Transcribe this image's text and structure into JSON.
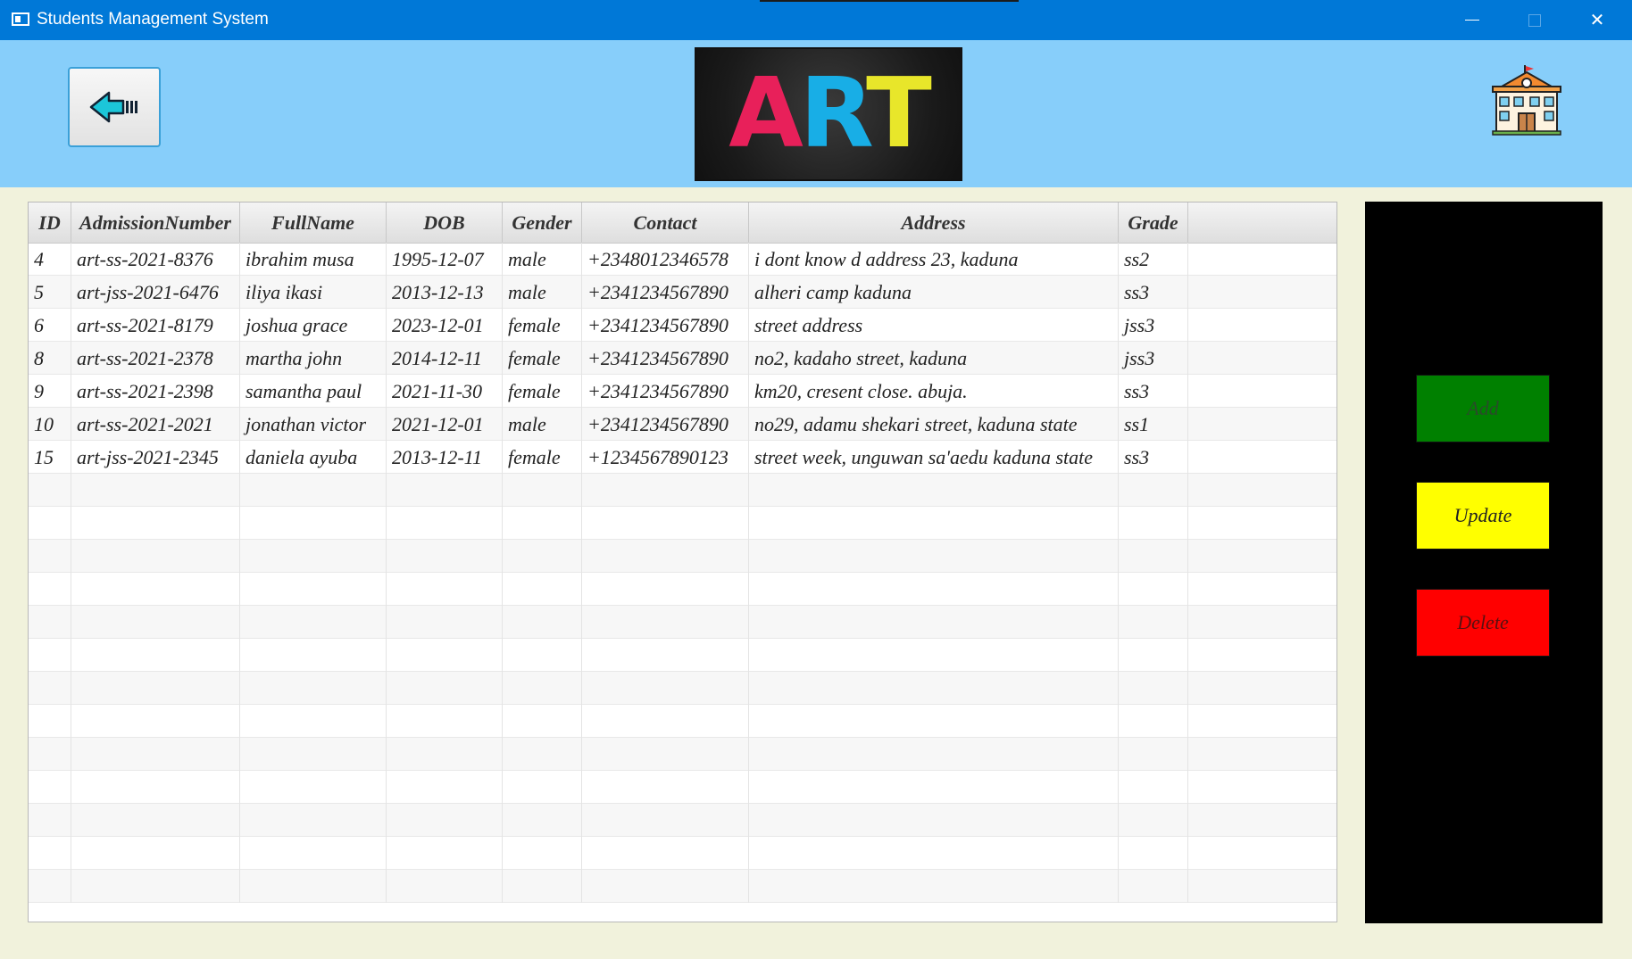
{
  "window": {
    "title": "Students Management System",
    "minimize_glyph": "–",
    "maximize_glyph": "□",
    "close_glyph": "✕"
  },
  "header": {
    "back_icon": "back-arrow-icon",
    "logo_text": [
      "A",
      "R",
      "T"
    ],
    "logo_colors": [
      "#e8205a",
      "#18aee6",
      "#e8e62a"
    ],
    "school_icon": "school-building-icon"
  },
  "table": {
    "columns": [
      "ID",
      "AdmissionNumber",
      "FullName",
      "DOB",
      "Gender",
      "Contact",
      "Address",
      "Grade",
      ""
    ],
    "rows": [
      [
        "4",
        "art-ss-2021-8376",
        "ibrahim musa",
        "1995-12-07",
        "male",
        "+2348012346578",
        "i dont know d address 23, kaduna",
        "ss2"
      ],
      [
        "5",
        "art-jss-2021-6476",
        "iliya ikasi",
        "2013-12-13",
        "male",
        "+2341234567890",
        "alheri camp kaduna",
        "ss3"
      ],
      [
        "6",
        "art-ss-2021-8179",
        "joshua grace",
        "2023-12-01",
        "female",
        "+2341234567890",
        "street address",
        "jss3"
      ],
      [
        "8",
        "art-ss-2021-2378",
        "martha john",
        "2014-12-11",
        "female",
        "+2341234567890",
        "no2, kadaho street, kaduna",
        "jss3"
      ],
      [
        "9",
        "art-ss-2021-2398",
        "samantha paul",
        "2021-11-30",
        "female",
        "+2341234567890",
        "km20, cresent close. abuja.",
        "ss3"
      ],
      [
        "10",
        "art-ss-2021-2021",
        "jonathan victor",
        "2021-12-01",
        "male",
        "+2341234567890",
        "no29, adamu shekari street, kaduna state",
        "ss1"
      ],
      [
        "15",
        "art-jss-2021-2345",
        "daniela ayuba",
        "2013-12-11",
        "female",
        "+1234567890123",
        "street week, unguwan sa'aedu kaduna state",
        "ss3"
      ]
    ]
  },
  "actions": {
    "add_label": "Add",
    "update_label": "Update",
    "delete_label": "Delete",
    "add_color": "#008000",
    "update_color": "#ffff00",
    "delete_color": "#ff0000"
  }
}
